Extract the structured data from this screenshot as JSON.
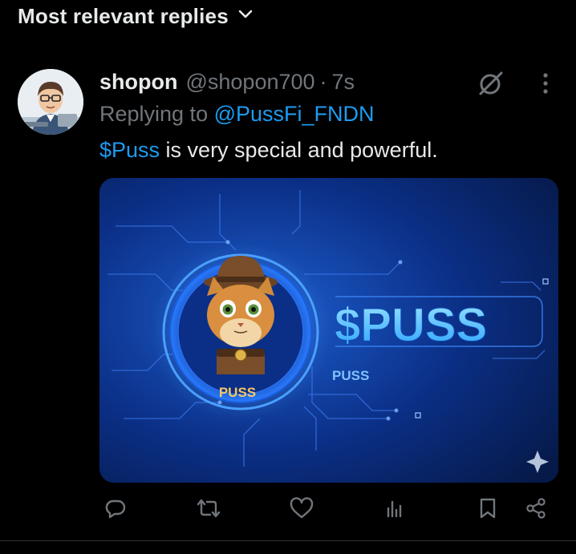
{
  "filter": {
    "label": "Most relevant replies",
    "icon": "chevron-down-icon"
  },
  "post": {
    "display_name": "shopon",
    "handle": "@shopon700",
    "separator": "·",
    "time": "7s",
    "replying_prefix": "Replying to",
    "replying_to": "@PussFi_FNDN",
    "text_cashtag": "$Puss",
    "text_rest": " is very special and powerful."
  },
  "media": {
    "coin_label": "PUSS",
    "headline": "$PUSS",
    "sub_label": "PUSS"
  },
  "actions": [
    {
      "name": "reply-button",
      "icon": "reply-icon"
    },
    {
      "name": "repost-button",
      "icon": "repost-icon"
    },
    {
      "name": "like-button",
      "icon": "heart-icon"
    },
    {
      "name": "views-button",
      "icon": "views-icon"
    },
    {
      "name": "bookmark-button",
      "icon": "bookmark-icon"
    },
    {
      "name": "share-button",
      "icon": "share-icon"
    }
  ],
  "colors": {
    "background": "#000000",
    "text": "#e7e9ea",
    "muted": "#71767b",
    "accent": "#1d9bf0",
    "media_blue": "#0a2a6e",
    "headline_blue": "#4fc3ff"
  }
}
